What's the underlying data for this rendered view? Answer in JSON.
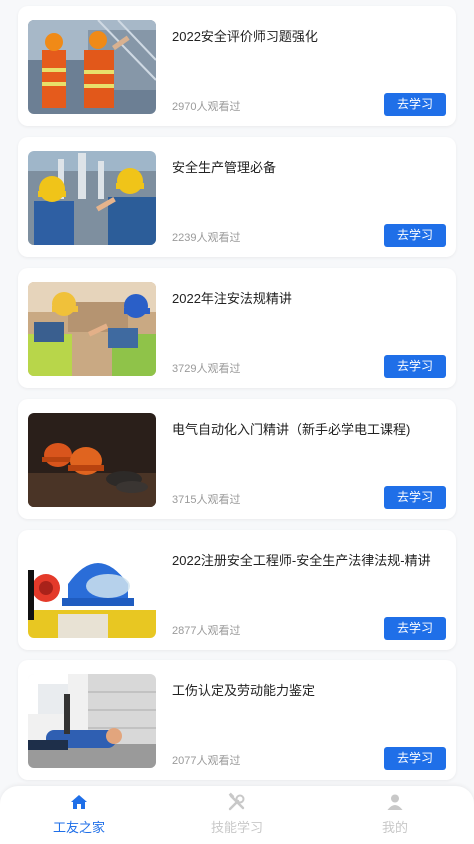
{
  "courses": [
    {
      "title": "2022安全评价师习题强化",
      "views": "2970人观看过",
      "button": "去学习"
    },
    {
      "title": "安全生产管理必备",
      "views": "2239人观看过",
      "button": "去学习"
    },
    {
      "title": "2022年注安法规精讲",
      "views": "3729人观看过",
      "button": "去学习"
    },
    {
      "title": "电气自动化入门精讲（新手必学电工课程)",
      "views": "3715人观看过",
      "button": "去学习"
    },
    {
      "title": "2022注册安全工程师-安全生产法律法规-精讲",
      "views": "2877人观看过",
      "button": "去学习"
    },
    {
      "title": "工伤认定及劳动能力鉴定",
      "views": "2077人观看过",
      "button": "去学习"
    }
  ],
  "tabbar": {
    "items": [
      {
        "label": "工友之家",
        "icon": "home-icon",
        "active": true
      },
      {
        "label": "技能学习",
        "icon": "tools-icon",
        "active": false
      },
      {
        "label": "我的",
        "icon": "user-icon",
        "active": false
      }
    ],
    "active_color": "#1f6fe8",
    "inactive_color": "#c8c8c8"
  },
  "colors": {
    "accent": "#1f6fe8",
    "background": "#f7f8fa"
  }
}
